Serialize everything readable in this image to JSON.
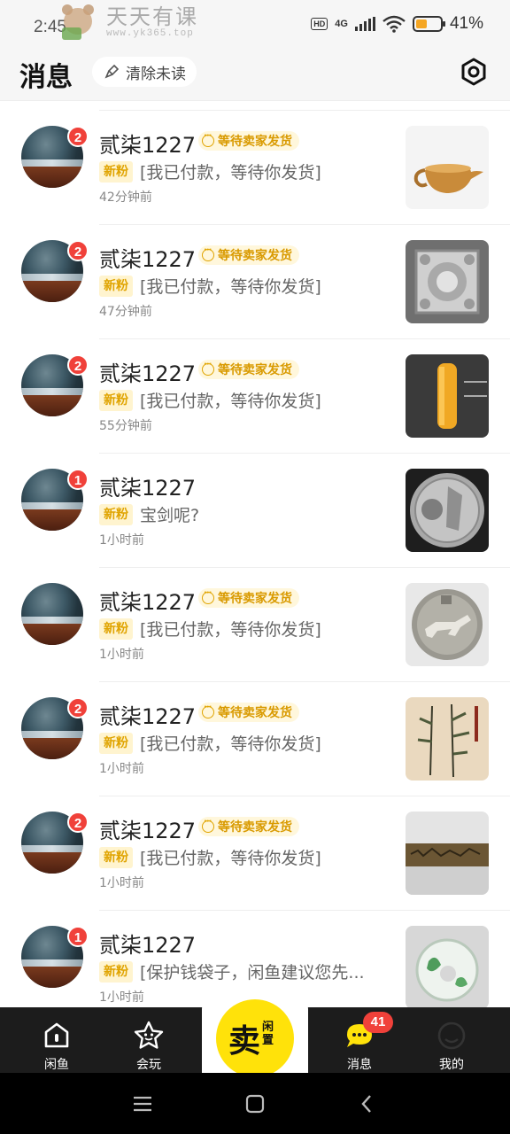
{
  "status_bar": {
    "time": "2:45",
    "network": "4G",
    "hd_label": "HD",
    "battery": "41%",
    "battery_level": 0.41
  },
  "watermark": {
    "title": "天天有课",
    "url": "www.yk365.top"
  },
  "header": {
    "title": "消息",
    "clear_label": "清除未读",
    "settings_icon": "settings-hexagon-icon"
  },
  "messages": [
    {
      "name": "贰柒1227",
      "badge": "2",
      "tag": "等待卖家发货",
      "fan": "新粉",
      "text": "[我已付款，等待你发货]",
      "time": "42分钟前",
      "thumb": "gold-teapot"
    },
    {
      "name": "贰柒1227",
      "badge": "2",
      "tag": "等待卖家发货",
      "fan": "新粉",
      "text": "[我已付款，等待你发货]",
      "time": "47分钟前",
      "thumb": "silver-box"
    },
    {
      "name": "贰柒1227",
      "badge": "2",
      "tag": "等待卖家发货",
      "fan": "新粉",
      "text": "[我已付款，等待你发货]",
      "time": "55分钟前",
      "thumb": "yellow-seal"
    },
    {
      "name": "贰柒1227",
      "badge": "1",
      "tag": "",
      "fan": "新粉",
      "text": "宝剑呢?",
      "time": "1小时前",
      "thumb": "silver-coin"
    },
    {
      "name": "贰柒1227",
      "badge": "",
      "tag": "等待卖家发货",
      "fan": "新粉",
      "text": "[我已付款，等待你发货]",
      "time": "1小时前",
      "thumb": "horse-medal"
    },
    {
      "name": "贰柒1227",
      "badge": "2",
      "tag": "等待卖家发货",
      "fan": "新粉",
      "text": "[我已付款，等待你发货]",
      "time": "1小时前",
      "thumb": "bamboo-scroll"
    },
    {
      "name": "贰柒1227",
      "badge": "2",
      "tag": "等待卖家发货",
      "fan": "新粉",
      "text": "[我已付款，等待你发货]",
      "time": "1小时前",
      "thumb": "long-painting"
    },
    {
      "name": "贰柒1227",
      "badge": "1",
      "tag": "",
      "fan": "新粉",
      "text": "[保护钱袋子，闲鱼建议您先...",
      "time": "1小时前",
      "thumb": "jade-disc"
    }
  ],
  "bottom_nav": {
    "home": "闲鱼",
    "fun": "会玩",
    "sell_main": "卖",
    "sell_sub": "闲置",
    "messages": "消息",
    "messages_badge": "41",
    "mine": "我的"
  },
  "colors": {
    "accent_yellow": "#ffe20a",
    "badge_red": "#f0413a",
    "tag_text": "#d99a00",
    "nav_bg": "#1c1c1c"
  }
}
